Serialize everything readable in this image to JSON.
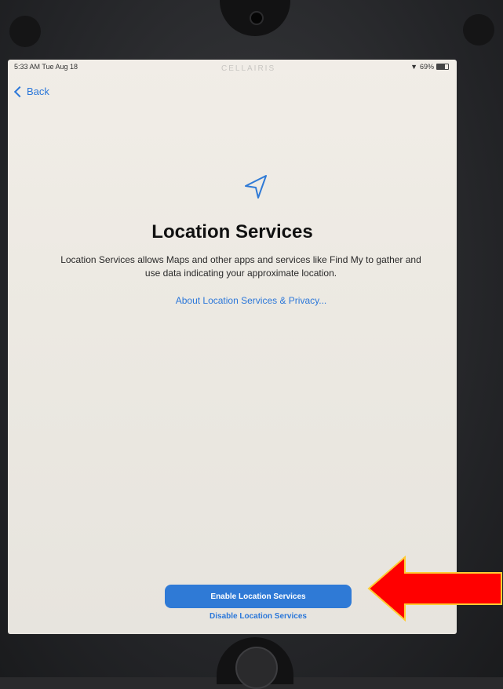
{
  "status_bar": {
    "time": "5:33 AM  Tue Aug 18",
    "brand": "CELLAIRIS",
    "battery": "69%",
    "battery_level": 0.69
  },
  "nav": {
    "back_label": "Back"
  },
  "main": {
    "icon": "location-arrow-icon",
    "title": "Location Services",
    "description": "Location Services allows Maps and other apps and services like Find My to gather and use data indicating your approximate location.",
    "privacy_link": "About Location Services & Privacy..."
  },
  "actions": {
    "enable_label": "Enable Location Services",
    "disable_label": "Disable Location Services"
  },
  "colors": {
    "accent": "#2f7ad6",
    "annotation_arrow": "#ff0000"
  }
}
